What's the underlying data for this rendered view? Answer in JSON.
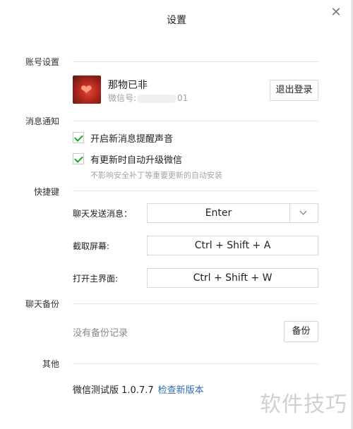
{
  "window": {
    "title": "设置",
    "close_glyph": "✕"
  },
  "sections": {
    "account": "账号设置",
    "notifications": "消息通知",
    "shortcuts": "快捷键",
    "backup": "聊天备份",
    "other": "其他"
  },
  "account": {
    "nickname": "那物已非",
    "wechat_id_prefix": "微信号:",
    "wechat_id_suffix": "01",
    "logout_label": "退出登录"
  },
  "notifications": {
    "options": [
      {
        "label": "开启新消息提醒声音",
        "checked": true
      },
      {
        "label": "有更新时自动升级微信",
        "checked": true
      }
    ],
    "hint": "不影响安全补丁等重要更新的自动安装"
  },
  "shortcuts": {
    "send_label": "聊天发送消息：",
    "send_value": "Enter",
    "screenshot_label": "截取屏幕:",
    "screenshot_value": "Ctrl + Shift + A",
    "open_main_label": "打开主界面:",
    "open_main_value": "Ctrl + Shift + W"
  },
  "backup": {
    "empty_text": "没有备份记录",
    "backup_label": "备份"
  },
  "other": {
    "version": "微信测试版 1.0.7.7",
    "check_update": "检查新版本"
  },
  "watermark": "软件技巧",
  "colors": {
    "check_green": "#1aad19",
    "link_blue": "#2b6cb0"
  }
}
